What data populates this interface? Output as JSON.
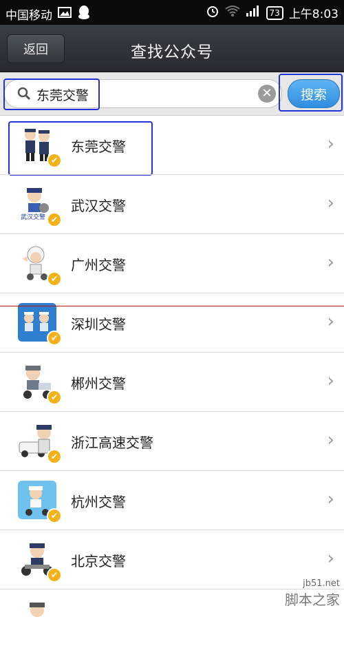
{
  "status_bar": {
    "carrier": "中国移动",
    "battery": "73",
    "time": "上午8:03"
  },
  "header": {
    "back_label": "返回",
    "title": "查找公众号"
  },
  "search": {
    "value": "东莞交警",
    "button_label": "搜索"
  },
  "results": [
    {
      "name": "东莞交警"
    },
    {
      "name": "武汉交警"
    },
    {
      "name": "广州交警"
    },
    {
      "name": "深圳交警"
    },
    {
      "name": "郴州交警"
    },
    {
      "name": "浙江高速交警"
    },
    {
      "name": "杭州交警"
    },
    {
      "name": "北京交警"
    }
  ],
  "watermark": {
    "line1": "jb51.net",
    "line2": "脚本之家"
  },
  "colors": {
    "highlight": "#1f33d6",
    "verified": "#f3b21a",
    "search_button": "#2f8ee0"
  }
}
